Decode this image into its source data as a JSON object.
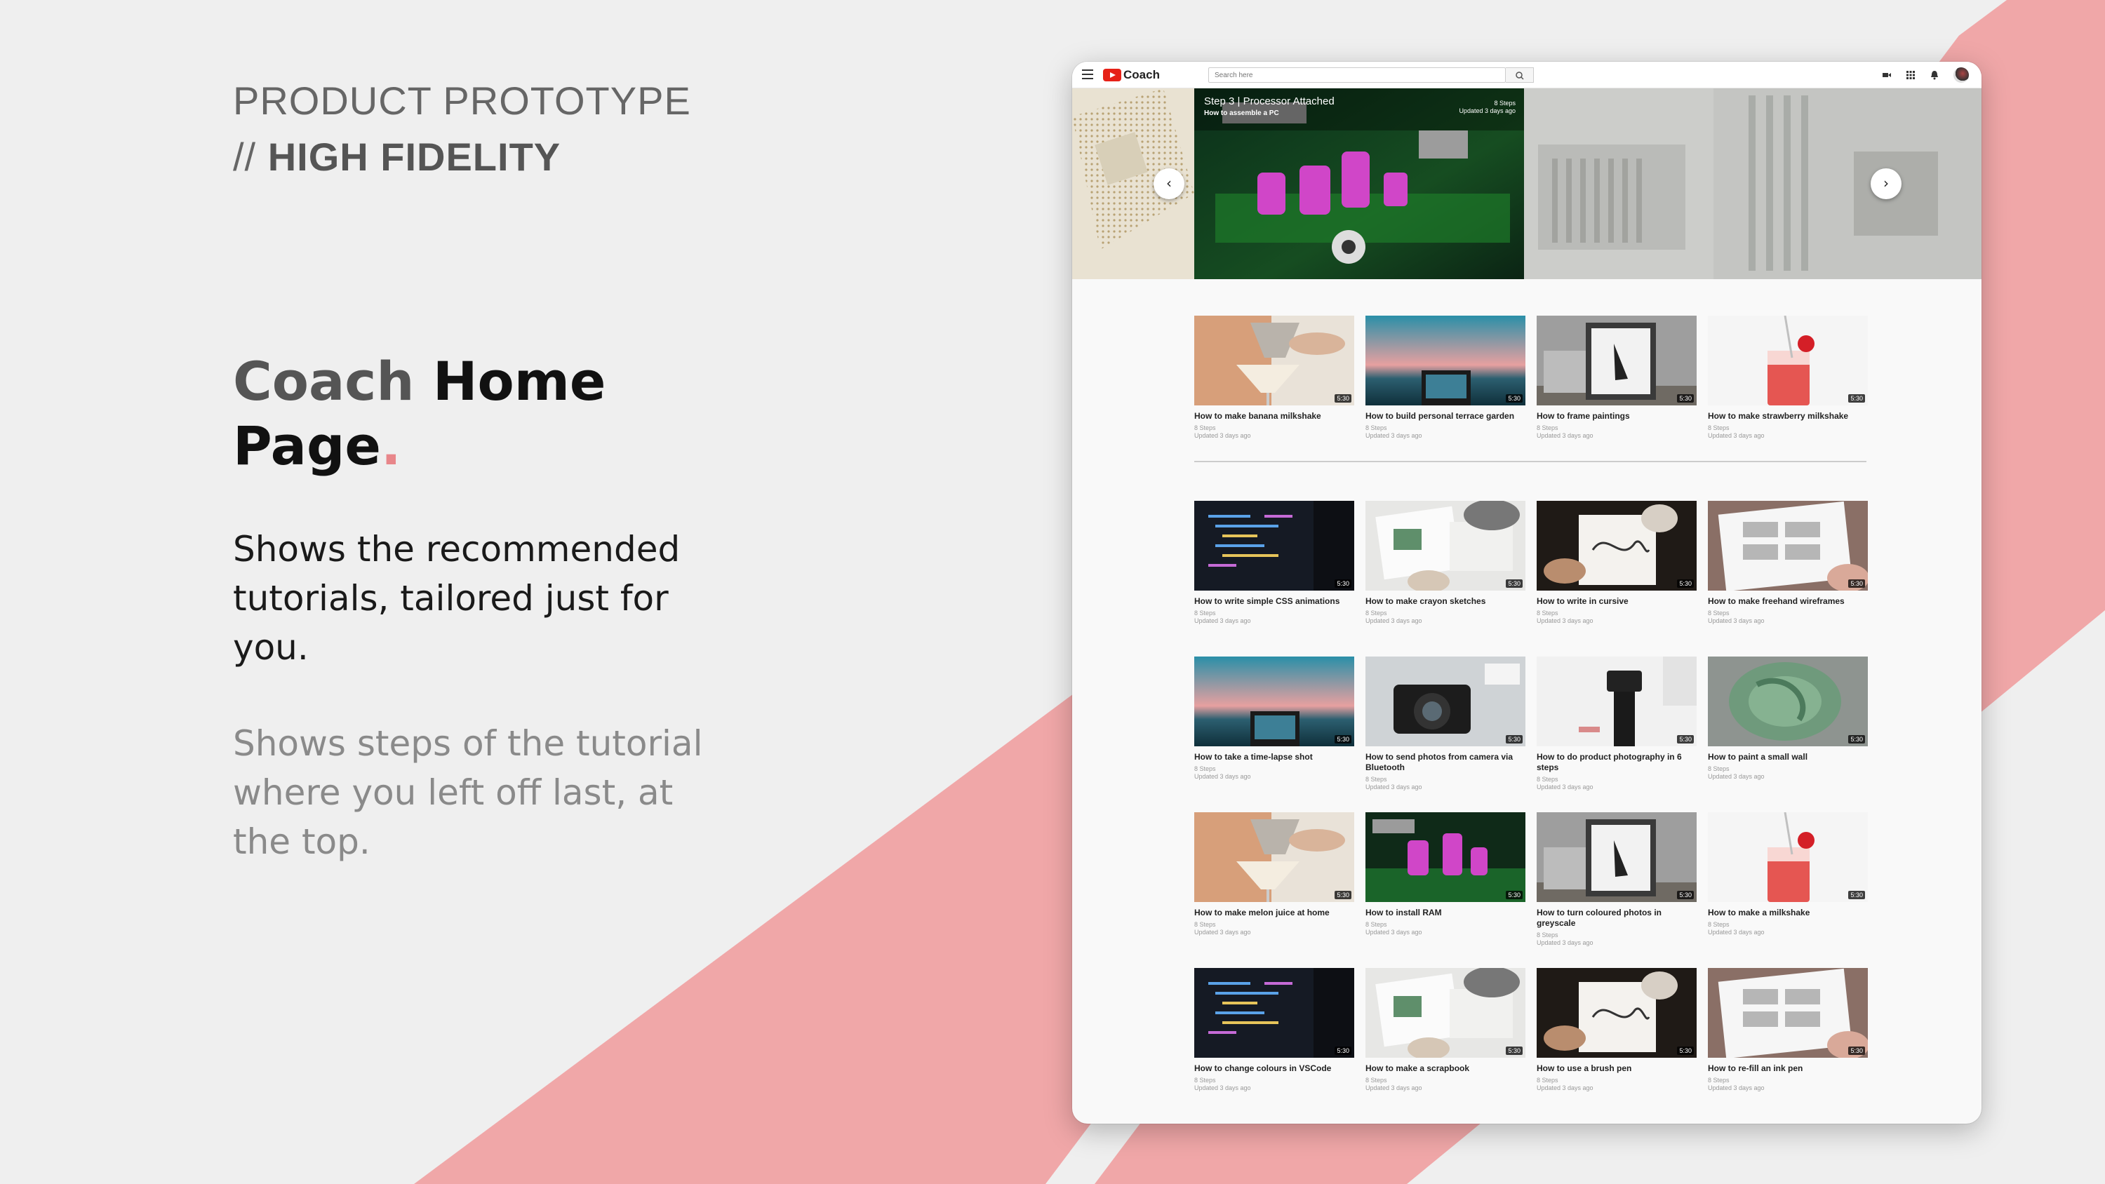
{
  "poster": {
    "eyebrow_line1": "PRODUCT PROTOTYPE",
    "eyebrow_slash": "//",
    "eyebrow_line2": "HIGH FIDELITY",
    "title_word1": "Coach",
    "title_word2": "Home",
    "title_word3": "Page",
    "title_dot": ".",
    "desc1": "Shows the recommended tutorials, tailored just for you.",
    "desc2": "Shows steps of the tutorial where you left off last, at the top.",
    "colors": {
      "background": "#efefef",
      "stripe": "#f0a7a8",
      "accent": "#e8868a"
    }
  },
  "app": {
    "brand": "Coach",
    "search_placeholder": "Search here",
    "brand_color": "#e62117",
    "icons": [
      "menu-icon",
      "search-icon",
      "video-camera-icon",
      "apps-grid-icon",
      "bell-icon",
      "avatar"
    ]
  },
  "hero": {
    "step_title": "Step 3 | Processor Attached",
    "tutorial_title": "How to assemble a PC",
    "steps": "8 Steps",
    "updated": "Updated 3 days ago",
    "prev_label": "‹",
    "next_label": "›"
  },
  "duration": "5:30",
  "sections": [
    {
      "rows": [
        [
          {
            "title": "How to make banana milkshake",
            "thumb": "cocktail",
            "steps": "8 Steps",
            "updated": "Updated 3 days ago"
          },
          {
            "title": "How to build personal terrace garden",
            "thumb": "sunset",
            "steps": "8 Steps",
            "updated": "Updated 3 days ago"
          },
          {
            "title": "How to frame paintings",
            "thumb": "frame",
            "steps": "8 Steps",
            "updated": "Updated 3 days ago"
          },
          {
            "title": "How to make strawberry milkshake",
            "thumb": "drink",
            "steps": "8 Steps",
            "updated": "Updated 3 days ago"
          }
        ]
      ]
    },
    {
      "rows": [
        [
          {
            "title": "How to write simple CSS animations",
            "thumb": "code",
            "steps": "8 Steps",
            "updated": "Updated 3 days ago"
          },
          {
            "title": "How to make crayon sketches",
            "thumb": "sketch",
            "steps": "8 Steps",
            "updated": "Updated 3 days ago"
          },
          {
            "title": "How to write in cursive",
            "thumb": "cursive",
            "steps": "8 Steps",
            "updated": "Updated 3 days ago"
          },
          {
            "title": "How to make freehand wireframes",
            "thumb": "wireframe",
            "steps": "8 Steps",
            "updated": "Updated 3 days ago"
          }
        ],
        [
          {
            "title": "How to take a time-lapse shot",
            "thumb": "sunset",
            "steps": "8 Steps",
            "updated": "Updated 3 days ago"
          },
          {
            "title": "How to send photos from camera via Bluetooth",
            "thumb": "camera",
            "steps": "8 Steps",
            "updated": "Updated 3 days ago"
          },
          {
            "title": "How to do product photography in 6 steps",
            "thumb": "studio",
            "steps": "8 Steps",
            "updated": "Updated 3 days ago"
          },
          {
            "title": "How to paint a small wall",
            "thumb": "paint",
            "steps": "8 Steps",
            "updated": "Updated 3 days ago"
          }
        ],
        [
          {
            "title": "How to make melon juice at home",
            "thumb": "cocktail",
            "steps": "8 Steps",
            "updated": "Updated 3 days ago"
          },
          {
            "title": "How to install RAM",
            "thumb": "circuit",
            "steps": "8 Steps",
            "updated": "Updated 3 days ago"
          },
          {
            "title": "How to turn coloured photos in greyscale",
            "thumb": "frame",
            "steps": "8 Steps",
            "updated": "Updated 3 days ago"
          },
          {
            "title": "How to make a milkshake",
            "thumb": "drink",
            "steps": "8 Steps",
            "updated": "Updated 3 days ago"
          }
        ],
        [
          {
            "title": "How to change colours in VSCode",
            "thumb": "code",
            "steps": "8 Steps",
            "updated": "Updated 3 days ago"
          },
          {
            "title": "How to make a scrapbook",
            "thumb": "sketch",
            "steps": "8 Steps",
            "updated": "Updated 3 days ago"
          },
          {
            "title": "How to use a brush pen",
            "thumb": "cursive",
            "steps": "8 Steps",
            "updated": "Updated 3 days ago"
          },
          {
            "title": "How to re-fill an ink pen",
            "thumb": "wireframe",
            "steps": "8 Steps",
            "updated": "Updated 3 days ago"
          }
        ]
      ]
    }
  ]
}
